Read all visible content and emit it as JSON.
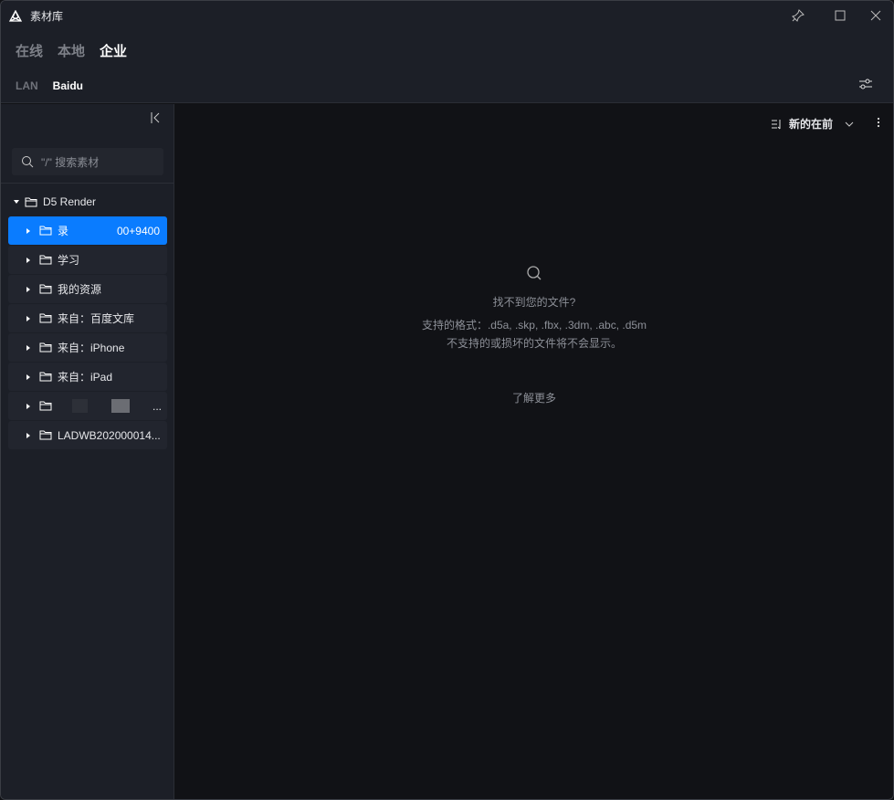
{
  "window": {
    "title": "素材库"
  },
  "tabs": [
    {
      "label": "在线"
    },
    {
      "label": "本地"
    },
    {
      "label": "企业"
    }
  ],
  "subtabs": [
    {
      "label": "LAN"
    },
    {
      "label": "Baidu"
    }
  ],
  "search": {
    "placeholder": "\"/\" 搜索素材"
  },
  "tree": {
    "root": "D5 Render",
    "items": [
      {
        "label": "录",
        "suffix": "00+9400"
      },
      {
        "label": "学习"
      },
      {
        "label": "我的资源"
      },
      {
        "label": "来自：百度文库"
      },
      {
        "label": "来自：iPhone"
      },
      {
        "label": "来自：iPad"
      },
      {
        "label": "",
        "suffix": "..."
      },
      {
        "label": "LADWB202000014..."
      }
    ]
  },
  "main": {
    "sort_label": "新的在前",
    "empty": {
      "title": "找不到您的文件?",
      "formats": "支持的格式：.d5a, .skp, .fbx, .3dm, .abc, .d5m",
      "note": "不支持的或损坏的文件将不会显示。",
      "learn_more": "了解更多"
    }
  },
  "colors": {
    "accent": "#0a7cff"
  }
}
